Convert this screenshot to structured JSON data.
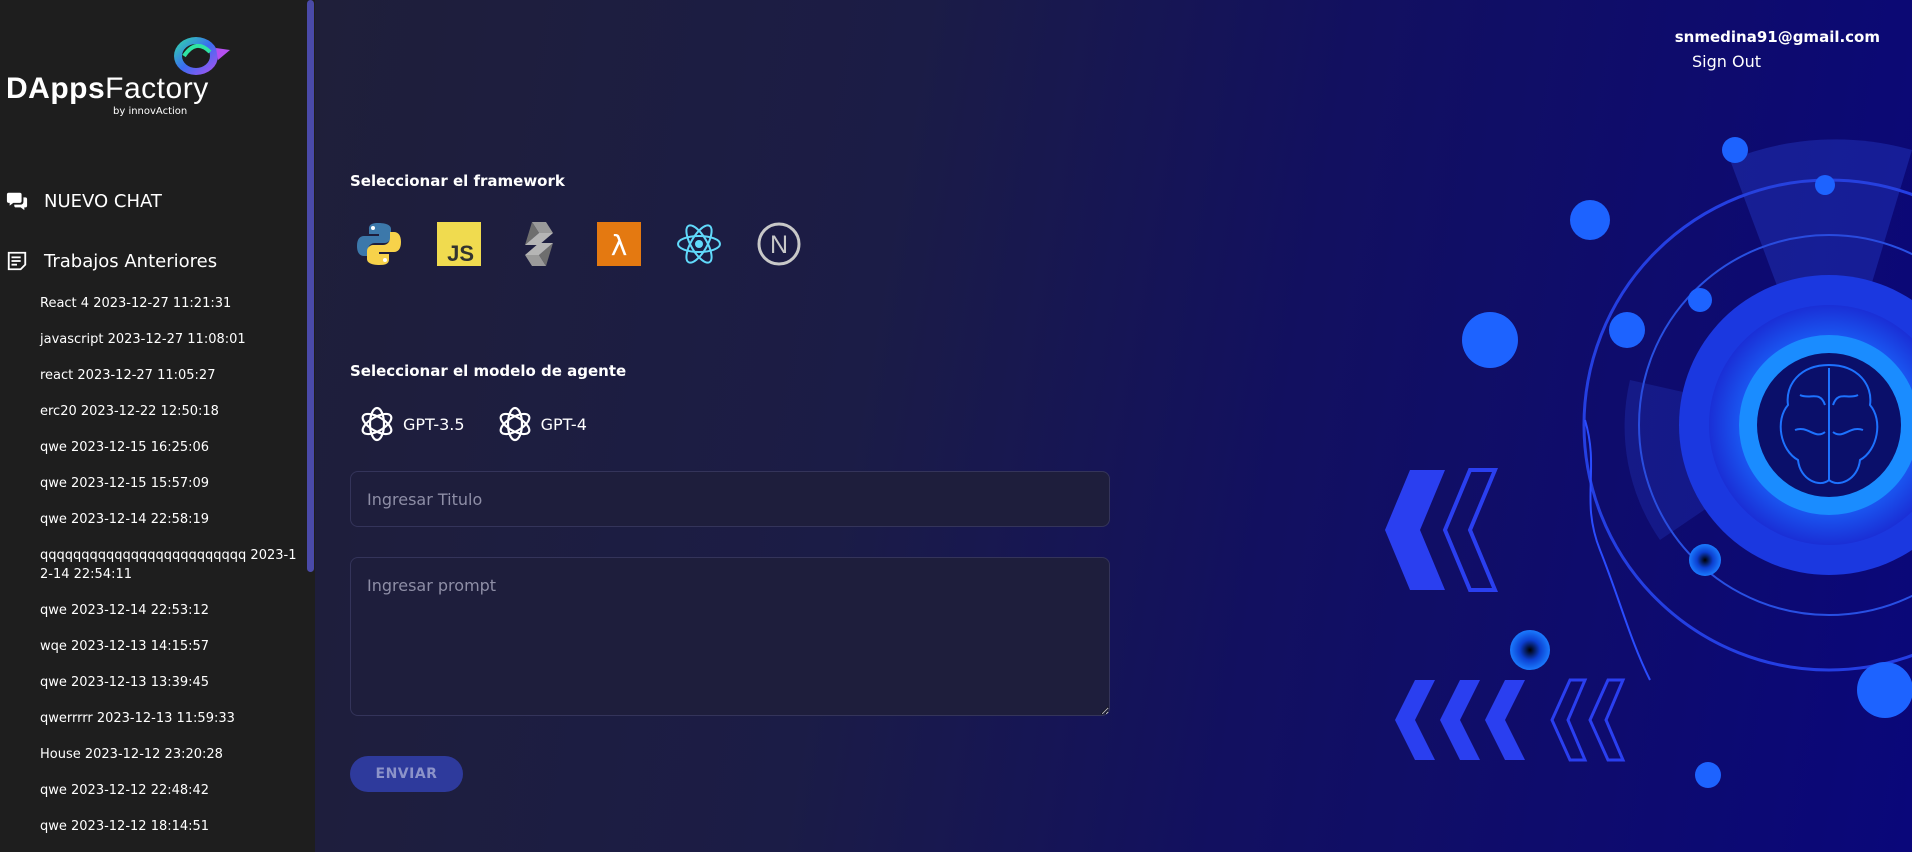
{
  "brand": {
    "name_bold": "DApps",
    "name_regular": "Factory",
    "tagline": "by innovAction"
  },
  "sidebar": {
    "new_chat_label": "NUEVO CHAT",
    "history_label": "Trabajos Anteriores",
    "history_items": [
      "React 4 2023-12-27 11:21:31",
      "javascript 2023-12-27 11:08:01",
      "react 2023-12-27 11:05:27",
      "erc20 2023-12-22 12:50:18",
      "qwe 2023-12-15 16:25:06",
      "qwe 2023-12-15 15:57:09",
      "qwe 2023-12-14 22:58:19",
      "qqqqqqqqqqqqqqqqqqqqqqqqq 2023-12-14 22:54:11",
      "qwe 2023-12-14 22:53:12",
      "wqe 2023-12-13 14:15:57",
      "qwe 2023-12-13 13:39:45",
      "qwerrrrr 2023-12-13 11:59:33",
      "House 2023-12-12 23:20:28",
      "qwe 2023-12-12 22:48:42",
      "qwe 2023-12-12 18:14:51"
    ]
  },
  "header": {
    "user_email": "snmedina91@gmail.com",
    "sign_out_label": "Sign Out"
  },
  "form": {
    "framework_title": "Seleccionar el framework",
    "frameworks": [
      {
        "name": "python-icon"
      },
      {
        "name": "javascript-icon",
        "text": "JS"
      },
      {
        "name": "solidity-icon"
      },
      {
        "name": "aws-lambda-icon",
        "text": "λ"
      },
      {
        "name": "react-icon"
      },
      {
        "name": "nextjs-icon",
        "text": "N"
      }
    ],
    "model_title": "Seleccionar el modelo de agente",
    "models": [
      {
        "label": "GPT-3.5"
      },
      {
        "label": "GPT-4"
      }
    ],
    "title_placeholder": "Ingresar Titulo",
    "prompt_placeholder": "Ingresar prompt",
    "send_label": "ENVIAR"
  },
  "colors": {
    "sidebar_bg": "#1e1e1e",
    "accent_blue": "#2e3a9c",
    "js_yellow": "#f0db4f",
    "lambda_orange": "#e47911",
    "react_cyan": "#61dafb"
  }
}
